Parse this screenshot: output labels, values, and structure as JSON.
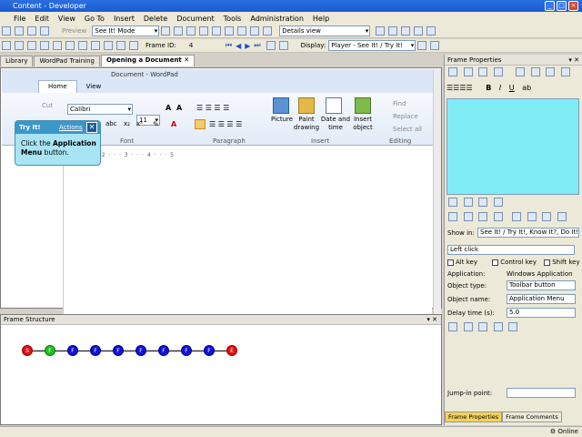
{
  "window": {
    "title": "Content - Developer"
  },
  "menu": [
    "File",
    "Edit",
    "View",
    "Go To",
    "Insert",
    "Delete",
    "Document",
    "Tools",
    "Administration",
    "Help"
  ],
  "toolbar1": {
    "preview_label": "Preview",
    "mode_select": "See It! Mode",
    "view_select": "Details view"
  },
  "toolbar2": {
    "frame_id_label": "Frame ID:",
    "frame_id_value": "4",
    "display_label": "Display:",
    "display_select": "Player - See It! / Try It!"
  },
  "doc_tabs": [
    {
      "label": "Library"
    },
    {
      "label": "WordPad Training"
    },
    {
      "label": "Opening a Document"
    }
  ],
  "wordpad": {
    "title": "Document - WordPad",
    "tabs": [
      "Home",
      "View"
    ],
    "cut": "Cut",
    "font_name": "Calibri",
    "font_size": "11",
    "groups": {
      "font": "Font",
      "paragraph": "Paragraph",
      "insert": "Insert",
      "editing": "Editing"
    },
    "insert_items": [
      "Picture",
      "Paint drawing",
      "Date and time",
      "Insert object"
    ],
    "editing_items": [
      "Find",
      "Replace",
      "Select all"
    ],
    "ruler": "· · · 1 · · · 2 · · · 3 · · · 4 · · · 5"
  },
  "tooltip": {
    "title": "Try It!",
    "actions": "Actions",
    "text1": "Click the ",
    "text_bold": "Application Menu",
    "text2": " button."
  },
  "frame_structure": {
    "title": "Frame Structure",
    "nodes": [
      "S",
      "F",
      "F",
      "F",
      "F",
      "F",
      "F",
      "F",
      "F",
      "E"
    ]
  },
  "frame_props": {
    "title": "Frame Properties",
    "show_in_label": "Show in:",
    "show_in_value": "See It! / Try It!, Know It?, Do It!",
    "action": "Left click",
    "alt_key": "Alt key",
    "ctrl_key": "Control key",
    "shift_key": "Shift key",
    "application_label": "Application:",
    "application_value": "Windows Application",
    "object_type_label": "Object type:",
    "object_type_value": "Toolbar button",
    "object_name_label": "Object name:",
    "object_name_value": "Application Menu",
    "delay_label": "Delay time (s):",
    "delay_value": "5.0",
    "jump_in_label": "Jump-in point:",
    "bottom_tabs": [
      "Frame Properties",
      "Frame Comments"
    ]
  },
  "status": {
    "online": "Online"
  },
  "colors": {
    "preview_bg": "#80ecf6",
    "tooltip_bg": "#a9e4f5",
    "node_start_end": "#e01010",
    "node_current": "#1cc41c",
    "node_frame": "#1010e0"
  }
}
